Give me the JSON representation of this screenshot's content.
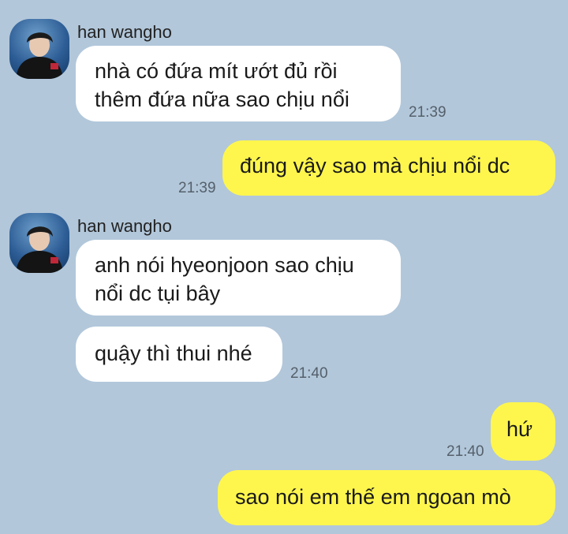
{
  "chat": {
    "sender_name": "han wangho",
    "messages": [
      {
        "text_line1": "nhà có đứa mít ướt đủ rồi",
        "text_line2": "thêm đứa nữa sao chịu nổi",
        "time": "21:39"
      },
      {
        "text": "đúng vậy sao mà chịu nổi dc",
        "time": "21:39"
      },
      {
        "text_line1": "anh nói hyeonjoon sao chịu",
        "text_line2": "nổi dc tụi bây"
      },
      {
        "text": "quậy thì thui nhé",
        "time": "21:40"
      },
      {
        "text": "hứ",
        "time": "21:40"
      },
      {
        "text": "sao nói em thế em ngoan mò"
      }
    ]
  },
  "colors": {
    "background": "#b2c7da",
    "incoming_bubble": "#ffffff",
    "outgoing_bubble": "#fff64d"
  },
  "icons": {
    "avatar": "profile-photo-avatar"
  }
}
